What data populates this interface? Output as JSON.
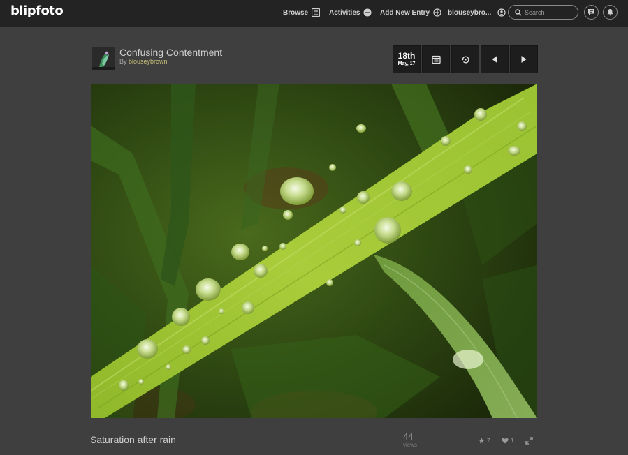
{
  "brand": {
    "logo": "blipfoto"
  },
  "nav": {
    "items": [
      {
        "label": "Browse",
        "icon": "browse-icon"
      },
      {
        "label": "Activities",
        "icon": "activities-icon"
      },
      {
        "label": "Add New Entry",
        "icon": "plus-circle-icon"
      },
      {
        "label": "blouseybro...",
        "icon": "account-icon"
      }
    ],
    "search": {
      "placeholder": "Search"
    },
    "buttons": [
      {
        "icon": "messages-icon"
      },
      {
        "icon": "notifications-bell-icon"
      }
    ]
  },
  "entry": {
    "title": "Confusing Contentment",
    "by_label": "By ",
    "author": "blouseybrown",
    "date": {
      "day": "18th",
      "month_year": "May, 17"
    },
    "controls": [
      "calendar-icon",
      "history-icon",
      "previous-arrow-icon",
      "next-arrow-icon"
    ],
    "photo": {
      "subject": "water droplets on grass blade"
    },
    "caption": "Saturation after rain",
    "views": {
      "count": "44",
      "label": "views"
    },
    "stars": "7",
    "hearts": "1",
    "expand_icon": "fullscreen-icon"
  },
  "colors": {
    "page_bg": "#3f3f3f",
    "topbar_bg": "#232323",
    "author_link": "#c9c07a"
  }
}
